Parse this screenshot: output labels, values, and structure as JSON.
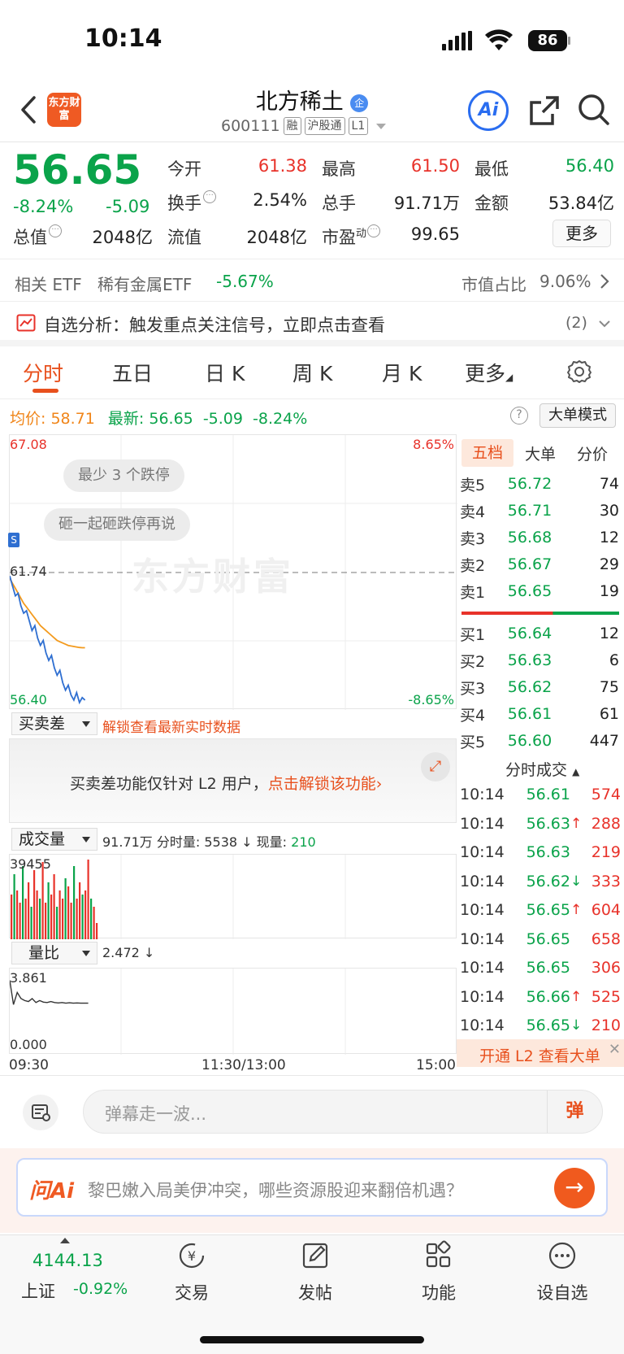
{
  "status": {
    "time": "10:14",
    "battery": "86"
  },
  "header": {
    "logo_text": "东方财富",
    "name": "北方稀土",
    "name_badge": "企",
    "code": "600111",
    "tags": [
      "融",
      "沪股通",
      "L1"
    ],
    "ai_label": "Ai"
  },
  "quote": {
    "price": "56.65",
    "change_pct": "-8.24%",
    "change": "-5.09",
    "open_label": "今开",
    "open": "61.38",
    "high_label": "最高",
    "high": "61.50",
    "low_label": "最低",
    "low": "56.40",
    "turnover_label": "换手",
    "turnover": "2.54%",
    "volume_label": "总手",
    "volume": "91.71万",
    "amount_label": "金额",
    "amount": "53.84亿",
    "mcap_label": "总值",
    "mcap": "2048亿",
    "float_label": "流值",
    "float": "2048亿",
    "pe_label": "市盈",
    "pe_sup": "动",
    "pe": "99.65",
    "more_button": "更多"
  },
  "etf": {
    "label": "相关 ETF",
    "name": "稀有金属ETF",
    "change": "-5.67%",
    "share_label": "市值占比",
    "share": "9.06%"
  },
  "alert": {
    "text": "自选分析：触发重点关注信号，立即点击查看",
    "count": "(2)"
  },
  "tabs": [
    "分时",
    "五日",
    "日 K",
    "周 K",
    "月 K",
    "更多"
  ],
  "chart_header": {
    "avg_label": "均价:",
    "avg": "58.71",
    "latest_label": "最新:",
    "latest": "56.65",
    "latest_change": "-5.09",
    "latest_pct": "-8.24%",
    "help": "?",
    "big_order_mode": "大单模式"
  },
  "chart_data": {
    "type": "line",
    "y_top": "67.08",
    "y_bottom": "56.40",
    "y_ref": "61.74",
    "pct_top": "8.65%",
    "pct_bottom": "-8.65%",
    "ylim": [
      56.4,
      67.08
    ],
    "series": [
      {
        "name": "",
        "color": "#2f6fd1",
        "values": [
          61.6,
          61.2,
          60.8,
          60.9,
          60.4,
          60.1,
          60.2,
          59.8,
          59.4,
          59.6,
          59.1,
          58.8,
          59.0,
          58.5,
          58.2,
          58.4,
          57.9,
          57.6,
          57.8,
          57.3,
          57.0,
          57.2,
          56.8,
          56.6,
          56.9,
          56.5,
          56.7,
          56.6
        ]
      },
      {
        "name": "",
        "color": "#f39a1d",
        "values": [
          61.5,
          61.3,
          61.1,
          60.9,
          60.7,
          60.5,
          60.35,
          60.2,
          60.05,
          59.9,
          59.75,
          59.6,
          59.5,
          59.4,
          59.3,
          59.2,
          59.1,
          59.0,
          58.95,
          58.9,
          58.85,
          58.8,
          58.78,
          58.76,
          58.74,
          58.72,
          58.71,
          58.71
        ]
      }
    ],
    "x_labels": [
      "09:30",
      "11:30/13:00",
      "15:00"
    ],
    "bubbles": [
      "最少 3 个跌停",
      "砸一起砸跌停再说"
    ],
    "watermark": "东方财富"
  },
  "spread": {
    "dropdown": "买卖差",
    "unlock": "解锁查看最新实时数据",
    "notice": "买卖差功能仅针对 L2 用户，",
    "notice_link": "点击解锁该功能"
  },
  "volume": {
    "dropdown": "成交量",
    "summary": "91.71万 分时量: 5538 ↓ 现量:",
    "current": "210",
    "max": "39455",
    "bars": [
      0.55,
      0.8,
      0.6,
      0.45,
      0.9,
      0.5,
      0.7,
      0.4,
      0.85,
      0.6,
      0.5,
      0.95,
      0.45,
      0.7,
      0.55,
      0.8,
      0.4,
      0.6,
      0.5,
      0.75,
      0.65,
      0.45,
      0.9,
      0.5,
      0.7,
      0.55,
      0.6,
      0.98,
      0.5,
      0.4,
      0.2
    ]
  },
  "ratio": {
    "dropdown": "量比",
    "value": "2.472 ↓",
    "top": "3.861",
    "bottom": "0.000",
    "values": [
      3.6,
      2.4,
      3.0,
      2.7,
      2.6,
      2.55,
      2.7,
      2.5,
      2.6,
      2.52,
      2.5,
      2.55,
      2.5,
      2.48,
      2.5,
      2.47,
      2.49,
      2.47,
      2.48,
      2.47,
      2.47,
      2.47
    ]
  },
  "orderbook": {
    "tabs": [
      "五档",
      "大单",
      "分价"
    ],
    "asks": [
      {
        "label": "卖5",
        "price": "56.72",
        "vol": "74"
      },
      {
        "label": "卖4",
        "price": "56.71",
        "vol": "30"
      },
      {
        "label": "卖3",
        "price": "56.68",
        "vol": "12"
      },
      {
        "label": "卖2",
        "price": "56.67",
        "vol": "29"
      },
      {
        "label": "卖1",
        "price": "56.65",
        "vol": "19"
      }
    ],
    "bids": [
      {
        "label": "买1",
        "price": "56.64",
        "vol": "12"
      },
      {
        "label": "买2",
        "price": "56.63",
        "vol": "6"
      },
      {
        "label": "买3",
        "price": "56.62",
        "vol": "75"
      },
      {
        "label": "买4",
        "price": "56.61",
        "vol": "61"
      },
      {
        "label": "买5",
        "price": "56.60",
        "vol": "447"
      }
    ],
    "trades_title": "分时成交",
    "trades": [
      {
        "time": "10:14",
        "price": "56.61",
        "arrow": "",
        "vol": "574"
      },
      {
        "time": "10:14",
        "price": "56.63",
        "arrow": "↑",
        "vol": "288"
      },
      {
        "time": "10:14",
        "price": "56.63",
        "arrow": "",
        "vol": "219"
      },
      {
        "time": "10:14",
        "price": "56.62",
        "arrow": "↓",
        "vol": "333"
      },
      {
        "time": "10:14",
        "price": "56.65",
        "arrow": "↑",
        "vol": "604"
      },
      {
        "time": "10:14",
        "price": "56.65",
        "arrow": "",
        "vol": "658"
      },
      {
        "time": "10:14",
        "price": "56.65",
        "arrow": "",
        "vol": "306"
      },
      {
        "time": "10:14",
        "price": "56.66",
        "arrow": "↑",
        "vol": "525"
      },
      {
        "time": "10:14",
        "price": "56.65",
        "arrow": "↓",
        "vol": "210"
      }
    ],
    "l2_banner": "开通 L2 查看大单"
  },
  "danmaku": {
    "placeholder": "弹幕走一波...",
    "send": "弹"
  },
  "ask_ai": {
    "brand": "问Ai",
    "question": "黎巴嫩入局美伊冲突，哪些资源股迎来翻倍机遇？"
  },
  "bottom_nav": {
    "index_value": "4144.13",
    "index_name": "上证",
    "index_change": "-0.92%",
    "items": [
      "交易",
      "发帖",
      "功能",
      "设自选"
    ]
  }
}
